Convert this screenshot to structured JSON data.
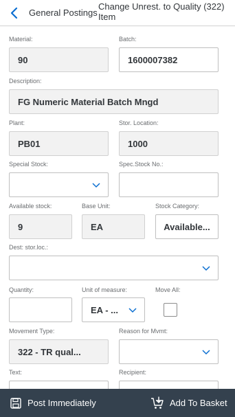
{
  "header": {
    "group": "General Postings",
    "title": "Change Unrest. to Quality (322) Item"
  },
  "form": {
    "material": {
      "label": "Material:",
      "value": "90"
    },
    "batch": {
      "label": "Batch:",
      "value": "1600007382"
    },
    "description": {
      "label": "Description:",
      "value": "FG Numeric Material Batch Mngd"
    },
    "plant": {
      "label": "Plant:",
      "value": "PB01"
    },
    "stor_location": {
      "label": "Stor. Location:",
      "value": "1000"
    },
    "special_stock": {
      "label": "Special Stock:",
      "value": ""
    },
    "spec_stock_no": {
      "label": "Spec.Stock No.:",
      "value": ""
    },
    "available_stock": {
      "label": "Available stock:",
      "value": "9"
    },
    "base_unit": {
      "label": "Base Unit:",
      "value": "EA"
    },
    "stock_category": {
      "label": "Stock Category:",
      "value": "Available..."
    },
    "dest_stor_loc": {
      "label": "Dest: stor.loc.:",
      "value": ""
    },
    "quantity": {
      "label": "Quantity:",
      "value": ""
    },
    "unit_of_measure": {
      "label": "Unit of measure:",
      "value": "EA - ..."
    },
    "move_all": {
      "label": "Move All:",
      "checked": false
    },
    "movement_type": {
      "label": "Movement Type:",
      "value": "322 - TR qual..."
    },
    "reason_for_mvmt": {
      "label": "Reason for Mvmt:",
      "value": ""
    },
    "text": {
      "label": "Text:"
    },
    "recipient": {
      "label": "Recipient:"
    }
  },
  "footer": {
    "post_label": "Post Immediately",
    "basket_label": "Add To Basket"
  },
  "colors": {
    "accent": "#0a6ed1",
    "footer_bg": "#34414e",
    "readonly_bg": "#f2f2f2"
  },
  "icons": {
    "back": "chevron-left-icon",
    "dropdown": "chevron-down-icon",
    "post": "save-disk-icon",
    "basket": "cart-add-icon"
  }
}
